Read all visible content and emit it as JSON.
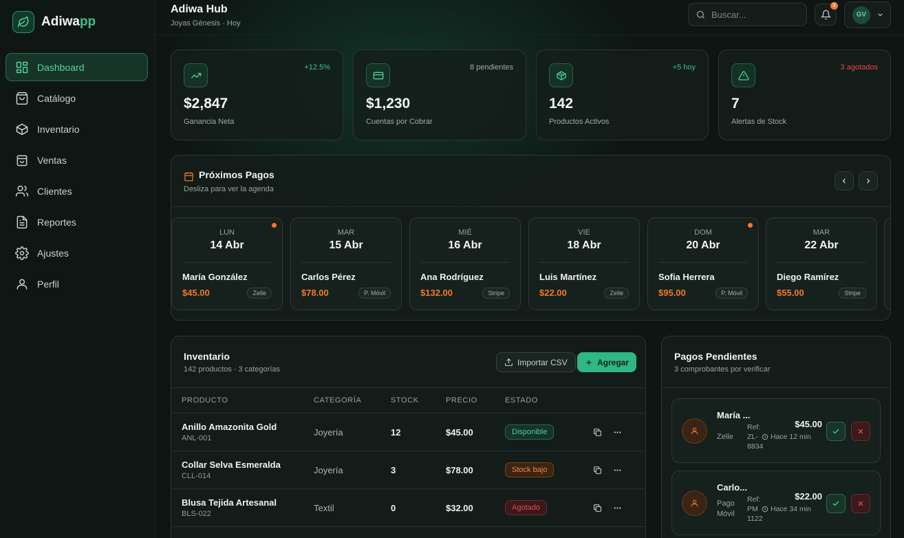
{
  "brand": {
    "name_main": "Adiwa",
    "name_accent": "pp",
    "accent_color": "#3fc08d"
  },
  "sidebar": {
    "items": [
      {
        "label": "Dashboard",
        "icon": "layout-grid-icon",
        "active": true
      },
      {
        "label": "Catálogo",
        "icon": "shopping-bag-icon"
      },
      {
        "label": "Inventario",
        "icon": "box-icon"
      },
      {
        "label": "Ventas",
        "icon": "cart-icon"
      },
      {
        "label": "Clientes",
        "icon": "users-icon"
      },
      {
        "label": "Reportes",
        "icon": "file-text-icon"
      },
      {
        "label": "Ajustes",
        "icon": "gear-icon"
      },
      {
        "label": "Perfil",
        "icon": "user-icon"
      }
    ]
  },
  "header": {
    "title": "Adiwa Hub",
    "subtitle": "Joyas Génesis · Hoy",
    "search_placeholder": "Buscar...",
    "notification_count": "3",
    "user_initials": "GV"
  },
  "stats": [
    {
      "value": "$2,847",
      "label": "Ganancia Neta",
      "badge": "+12.5%",
      "badge_color": "#3fc08d",
      "icon": "trending-up-icon"
    },
    {
      "value": "$1,230",
      "label": "Cuentas por Cobrar",
      "badge": "8 pendientes",
      "badge_color": "#a0aca6",
      "icon": "credit-card-icon"
    },
    {
      "value": "142",
      "label": "Productos Activos",
      "badge": "+5 hoy",
      "badge_color": "#3fc08d",
      "icon": "package-icon"
    },
    {
      "value": "7",
      "label": "Alertas de Stock",
      "badge": "3 agotados",
      "badge_color": "#e5484d",
      "icon": "alert-triangle-icon"
    }
  ],
  "upcoming": {
    "title": "Próximos Pagos",
    "subtitle": "Desliza para ver la agenda",
    "payments": [
      {
        "day": "LUN",
        "date": "14 Abr",
        "name": "María González",
        "amount": "$45.00",
        "method": "Zelle",
        "alert": true
      },
      {
        "day": "MAR",
        "date": "15 Abr",
        "name": "Carlos Pérez",
        "amount": "$78.00",
        "method": "P. Móvil",
        "alert": false
      },
      {
        "day": "MIÉ",
        "date": "16 Abr",
        "name": "Ana Rodríguez",
        "amount": "$132.00",
        "method": "Stripe",
        "alert": false
      },
      {
        "day": "VIE",
        "date": "18 Abr",
        "name": "Luis Martínez",
        "amount": "$22.00",
        "method": "Zelle",
        "alert": false
      },
      {
        "day": "DOM",
        "date": "20 Abr",
        "name": "Sofia Herrera",
        "amount": "$95.00",
        "method": "P. Móvil",
        "alert": true
      },
      {
        "day": "MAR",
        "date": "22 Abr",
        "name": "Diego Ramírez",
        "amount": "$55.00",
        "method": "Stripe",
        "alert": false
      }
    ]
  },
  "inventory": {
    "title": "Inventario",
    "subtitle": "142 productos · 3 categorías",
    "import_label": "Importar CSV",
    "add_label": "Agregar",
    "columns": [
      "PRODUCTO",
      "CATEGORÍA",
      "STOCK",
      "PRECIO",
      "ESTADO"
    ],
    "rows": [
      {
        "name": "Anillo Amazonita Gold",
        "sku": "ANL-001",
        "category": "Joyería",
        "stock": "12",
        "price": "$45.00",
        "status": "Disponible",
        "status_type": "ok"
      },
      {
        "name": "Collar Selva Esmeralda",
        "sku": "CLL-014",
        "category": "Joyería",
        "stock": "3",
        "price": "$78.00",
        "status": "Stock bajo",
        "status_type": "low"
      },
      {
        "name": "Blusa Tejida Artesanal",
        "sku": "BLS-022",
        "category": "Textil",
        "stock": "0",
        "price": "$32.00",
        "status": "Agotado",
        "status_type": "out"
      }
    ]
  },
  "pending": {
    "title": "Pagos Pendientes",
    "subtitle": "3 comprobantes por verificar",
    "items": [
      {
        "name": "María ...",
        "method": "Zelle",
        "ref": [
          "Ref:",
          "ZL-",
          "8834"
        ],
        "amount": "$45.00",
        "time": "Hace 12 min"
      },
      {
        "name": "Carlo...",
        "method_lines": [
          "Pago",
          "Móvil"
        ],
        "ref": [
          "Ref:",
          "PM",
          "1122"
        ],
        "amount": "$22.00",
        "time": "Hace 34 min"
      }
    ]
  }
}
